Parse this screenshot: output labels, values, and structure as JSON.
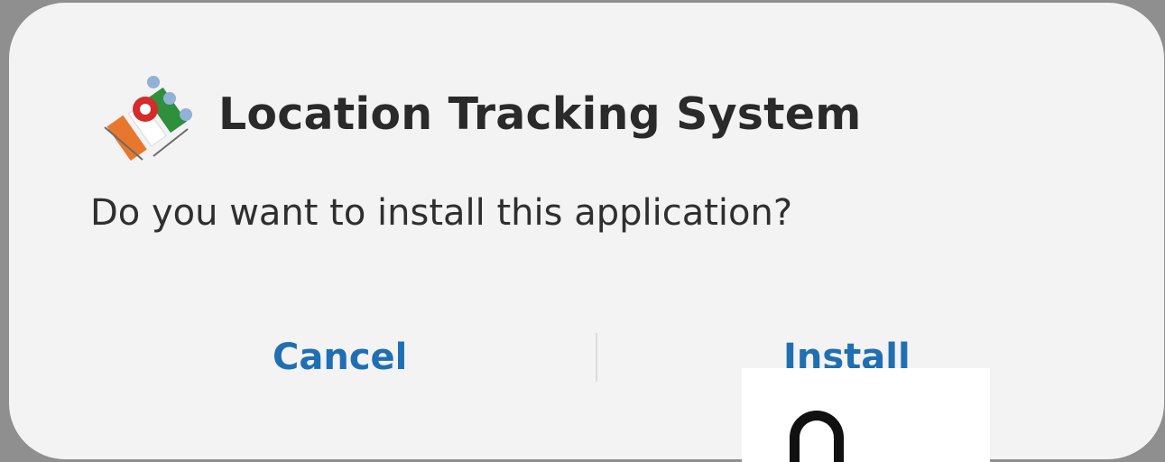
{
  "dialog": {
    "app_title": "Location Tracking System",
    "prompt": "Do you want to install this application?",
    "cancel_label": "Cancel",
    "install_label": "Install"
  },
  "icons": {
    "app_icon": "app-logo-icon"
  },
  "colors": {
    "background": "#8f8f8f",
    "dialog": "#f3f3f3",
    "title_text": "#2a2a2a",
    "button_text": "#1f6fb2"
  }
}
